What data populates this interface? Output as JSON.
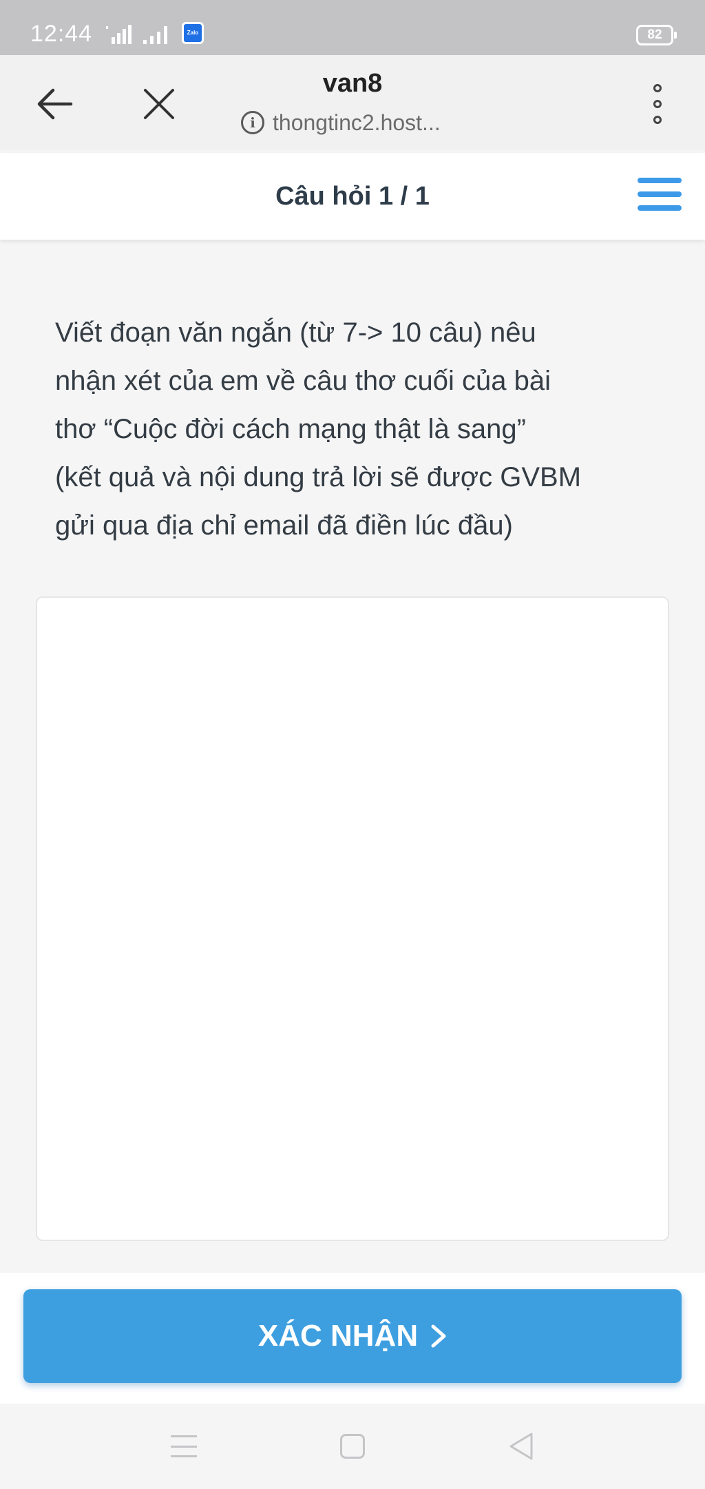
{
  "status_bar": {
    "time": "12:44",
    "battery": "82",
    "app_icon_label": "Zalo"
  },
  "browser": {
    "title": "van8",
    "url": "thongtinc2.host...",
    "icons": [
      "back-arrow-icon",
      "close-icon",
      "info-icon",
      "more-vert-icon"
    ]
  },
  "quiz": {
    "header_title": "Câu hỏi 1 / 1",
    "question_lines": [
      "Viết đoạn văn ngắn (từ 7-> 10 câu) nêu",
      "nhận xét của em về câu thơ cuối của bài",
      "thơ “Cuộc đời cách mạng thật là sang”",
      "(kết quả và nội dung trả lời sẽ được GVBM",
      "gửi qua địa chỉ email đã điền lúc đầu)"
    ],
    "answer_value": "",
    "confirm_label": "XÁC NHẬN",
    "accent_color": "#3e9fe0"
  },
  "nav_bar": {
    "icons": [
      "menu-icon",
      "home-icon",
      "back-triangle-icon"
    ]
  }
}
